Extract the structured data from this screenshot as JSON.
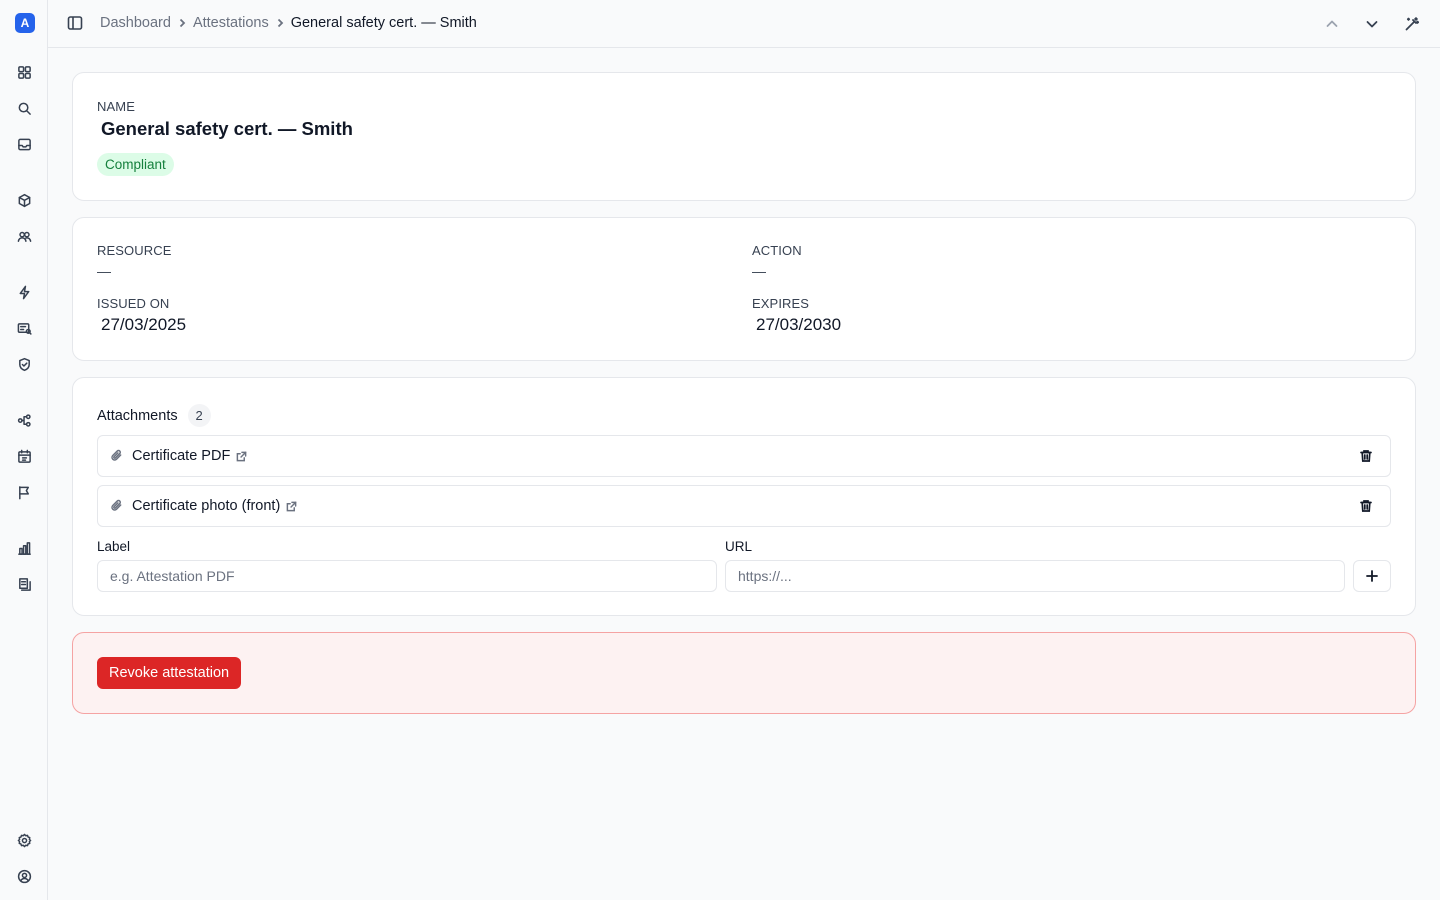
{
  "app": {
    "logo_letter": "A"
  },
  "sidebar": {
    "items": [
      {
        "icon": "dashboard-icon"
      },
      {
        "icon": "search-icon"
      },
      {
        "icon": "inbox-icon"
      },
      {
        "icon": "box-icon"
      },
      {
        "icon": "users-icon"
      },
      {
        "icon": "lightning-icon"
      },
      {
        "icon": "id-card-icon"
      },
      {
        "icon": "shield-check-icon"
      },
      {
        "icon": "workflow-icon"
      },
      {
        "icon": "calendar-icon"
      },
      {
        "icon": "flag-icon"
      },
      {
        "icon": "bar-chart-icon"
      },
      {
        "icon": "ledger-icon"
      },
      {
        "icon": "settings-icon"
      },
      {
        "icon": "account-icon"
      }
    ]
  },
  "breadcrumb": {
    "items": [
      "Dashboard",
      "Attestations"
    ],
    "current": "General safety cert. — Smith"
  },
  "header_card": {
    "name_label": "NAME",
    "name": "General safety cert. — Smith",
    "status": "Compliant"
  },
  "details": {
    "resource_label": "RESOURCE",
    "resource_value": "—",
    "action_label": "ACTION",
    "action_value": "—",
    "issued_label": "ISSUED ON",
    "issued_value": "27/03/2025",
    "expires_label": "EXPIRES",
    "expires_value": "27/03/2030"
  },
  "attachments": {
    "title": "Attachments",
    "count": "2",
    "items": [
      {
        "label": "Certificate PDF"
      },
      {
        "label": "Certificate photo (front)"
      }
    ],
    "form": {
      "label_field_label": "Label",
      "label_placeholder": "e.g. Attestation PDF",
      "url_field_label": "URL",
      "url_placeholder": "https://..."
    }
  },
  "danger": {
    "revoke_label": "Revoke attestation"
  },
  "colors": {
    "accent": "#2563eb",
    "success_bg": "#dcfce7",
    "success_text": "#15803d",
    "danger": "#dc2626",
    "danger_bg": "#fdf2f2"
  }
}
